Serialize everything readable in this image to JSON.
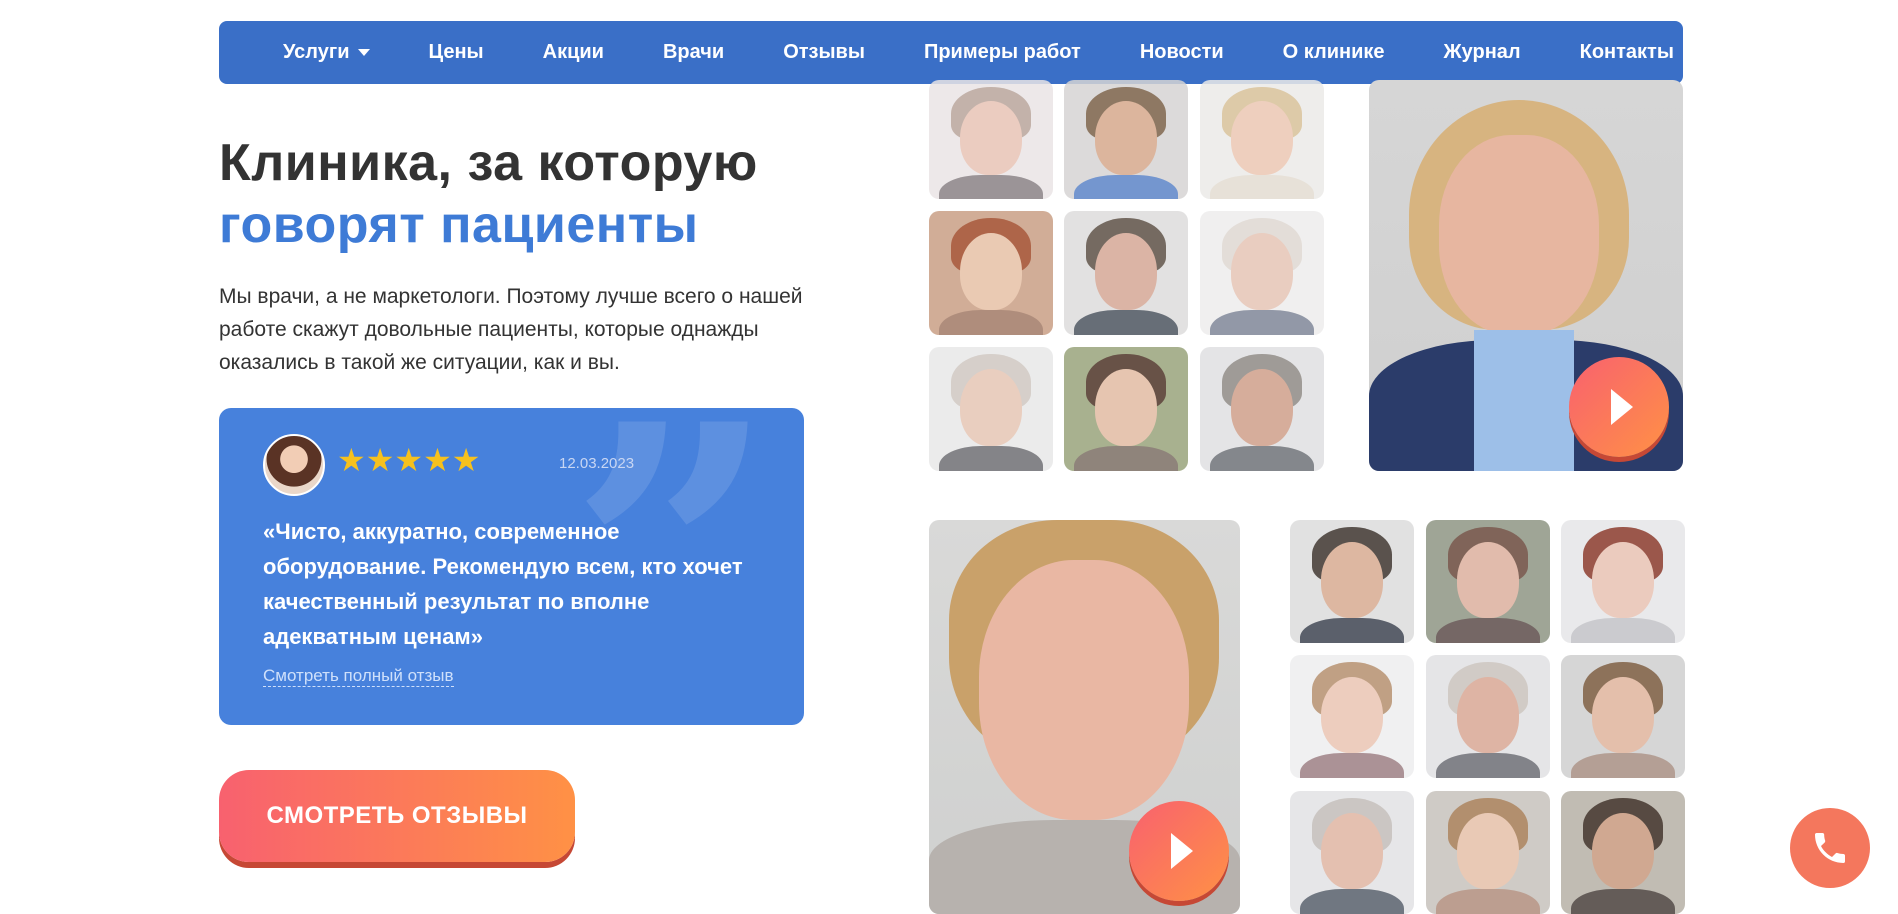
{
  "nav": {
    "items": [
      {
        "label": "Услуги",
        "has_dropdown": true
      },
      {
        "label": "Цены"
      },
      {
        "label": "Акции"
      },
      {
        "label": "Врачи"
      },
      {
        "label": "Отзывы"
      },
      {
        "label": "Примеры работ"
      },
      {
        "label": "Новости"
      },
      {
        "label": "О клинике"
      },
      {
        "label": "Журнал"
      },
      {
        "label": "Контакты"
      }
    ]
  },
  "hero": {
    "title_line1": "Клиника, за которую",
    "title_line2": "говорят пациенты",
    "lead": "Мы врачи, а не маркетологи. Поэтому лучше всего о нашей работе скажут довольные пациенты, которые однажды оказались в такой же ситуации, как и вы."
  },
  "review": {
    "rating": 5,
    "stars": "★★★★★",
    "date": "12.03.2023",
    "text": "«Чисто, аккуратно, современное оборудование. Рекомендую всем, кто хочет качественный результат по вполне адекватным ценам»",
    "link": "Смотреть полный отзыв",
    "quote_glyph": "”"
  },
  "cta": {
    "label": "СМОТРЕТЬ ОТЗЫВЫ"
  },
  "icons": {
    "play": "play-icon",
    "phone": "phone-icon",
    "caret": "caret-down-icon"
  },
  "colors": {
    "nav_bg": "#3a6fc7",
    "accent_blue": "#3e7bd6",
    "review_bg": "#4781dc",
    "cta_start": "#f8616f",
    "cta_end": "#ff9145",
    "star": "#f6c11e"
  }
}
